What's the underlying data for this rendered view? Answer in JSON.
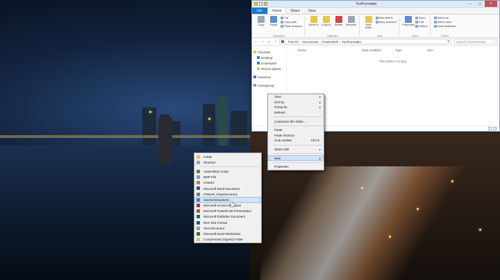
{
  "window": {
    "title": "TextFormatter",
    "ribbon_tabs": [
      "File",
      "Home",
      "Share",
      "View"
    ],
    "ribbon": {
      "clipboard": {
        "label": "Clipboard",
        "copy": "Copy",
        "paste": "Paste",
        "cut": "Cut",
        "copy_path": "Copy path",
        "paste_shortcut": "Paste shortcut"
      },
      "organize": {
        "label": "Organize",
        "move_to": "Move to",
        "copy_to": "Copy to",
        "delete": "Delete",
        "rename": "Rename"
      },
      "new": {
        "label": "New",
        "new_folder": "New folder",
        "new_item": "New item",
        "easy_access": "Easy access"
      },
      "open": {
        "label": "Open",
        "properties": "Properties",
        "open": "Open",
        "edit": "Edit",
        "history": "History"
      },
      "select": {
        "label": "Select",
        "select_all": "Select all",
        "select_none": "Select none",
        "invert_selection": "Invert selection"
      }
    },
    "address": {
      "path": [
        "This PC",
        "Documents",
        "PowerShell",
        "TextFormatter"
      ],
      "search_placeholder": "Search TextFormatter"
    },
    "nav": {
      "favorites": "Favorites",
      "desktop": "Desktop",
      "downloads": "Downloads",
      "recent": "Recent places",
      "onedrive": "OneDrive",
      "homegroup": "Homegroup"
    },
    "columns": {
      "name": "Name",
      "date": "Date modified",
      "type": "Type",
      "size": "Size"
    },
    "empty_text": "This folder is empty."
  },
  "context_menu": {
    "items": [
      {
        "label": "View",
        "arrow": "▸"
      },
      {
        "label": "Sort by",
        "arrow": "▸"
      },
      {
        "label": "Group by",
        "arrow": "▸"
      },
      {
        "label": "Refresh"
      },
      {
        "label": "Customize this folder..."
      },
      {
        "label": "Paste"
      },
      {
        "label": "Paste shortcut"
      },
      {
        "label": "Undo Delete",
        "shortcut": "Ctrl+Z"
      },
      {
        "label": "Share with",
        "arrow": "▸"
      },
      {
        "label": "New",
        "arrow": "▸"
      },
      {
        "label": "Properties"
      }
    ]
  },
  "new_submenu": {
    "items": [
      {
        "label": "Folder",
        "color": "#e8c64a"
      },
      {
        "label": "Shortcut",
        "color": "#8aa8d0"
      },
      {
        "label": "AutoHotkey Script",
        "color": "#4a8a4a"
      },
      {
        "label": "BMP File",
        "color": "#6aa0d8"
      },
      {
        "label": "Contact",
        "color": "#d07a3a"
      },
      {
        "label": "Microsoft Word Document",
        "color": "#2b5797"
      },
      {
        "label": "PSWAR_FlowDocument",
        "color": "#7a7a7a"
      },
      {
        "label": "Journal Document",
        "color": "#5a7ab0"
      },
      {
        "label": "Microsoft Access Database",
        "color": "#a4373a"
      },
      {
        "label": "Microsoft PowerPoint Presentation",
        "color": "#d24726"
      },
      {
        "label": "Microsoft Publisher Document",
        "color": "#077568"
      },
      {
        "label": "Rich Text Format",
        "color": "#2b5797"
      },
      {
        "label": "Text Document",
        "color": "#9a9a9a"
      },
      {
        "label": "Microsoft Excel Worksheet",
        "color": "#217346"
      },
      {
        "label": "Compressed (zipped) Folder",
        "color": "#e8c64a"
      }
    ]
  }
}
